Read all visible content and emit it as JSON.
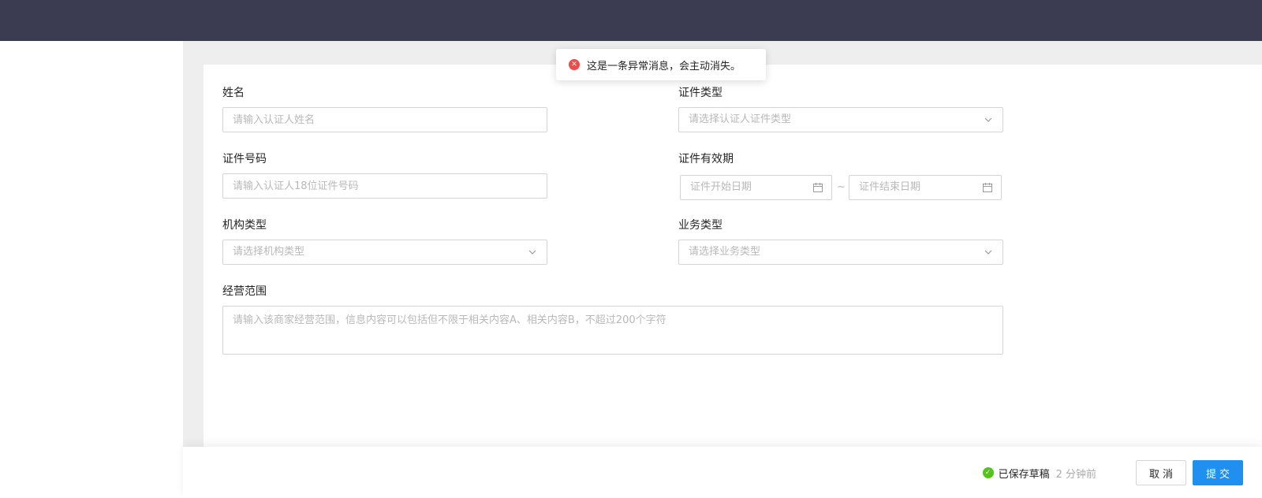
{
  "toast": {
    "message": "这是一条异常消息，会主动消失。",
    "icon": "error-circle-icon"
  },
  "form": {
    "name": {
      "label": "姓名",
      "placeholder": "请输入认证人姓名"
    },
    "id_type": {
      "label": "证件类型",
      "placeholder": "请选择认证人证件类型"
    },
    "id_number": {
      "label": "证件号码",
      "placeholder": "请输入认证人18位证件号码"
    },
    "id_validity": {
      "label": "证件有效期",
      "start_placeholder": "证件开始日期",
      "separator": "~",
      "end_placeholder": "证件结束日期"
    },
    "org_type": {
      "label": "机构类型",
      "placeholder": "请选择机构类型"
    },
    "biz_type": {
      "label": "业务类型",
      "placeholder": "请选择业务类型"
    },
    "scope": {
      "label": "经营范围",
      "placeholder": "请输入该商家经营范围，信息内容可以包括但不限于相关内容A、相关内容B，不超过200个字符"
    }
  },
  "footer": {
    "saved_text": "已保存草稿",
    "saved_time": "2 分钟前",
    "cancel_label": "取消",
    "submit_label": "提交"
  },
  "colors": {
    "topbar": "#3b3c52",
    "primary": "#1f8ff0",
    "error": "#f04b4b",
    "success": "#52c41a"
  }
}
